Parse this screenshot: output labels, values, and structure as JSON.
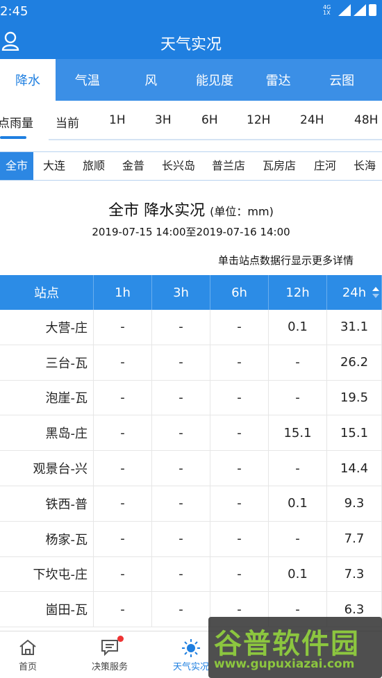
{
  "status_bar": {
    "time": "2:45",
    "network": "4G 1X"
  },
  "app": {
    "title": "天气实况"
  },
  "main_tabs": [
    {
      "label": "降水",
      "active": true
    },
    {
      "label": "气温"
    },
    {
      "label": "风"
    },
    {
      "label": "能见度"
    },
    {
      "label": "雷达"
    },
    {
      "label": "云图"
    }
  ],
  "time_tabs": [
    {
      "label": "站点雨量",
      "active": true
    },
    {
      "label": "当前"
    },
    {
      "label": "1H"
    },
    {
      "label": "3H"
    },
    {
      "label": "6H"
    },
    {
      "label": "12H"
    },
    {
      "label": "24H"
    },
    {
      "label": "48H"
    }
  ],
  "area_tabs": [
    {
      "label": "全市",
      "active": true
    },
    {
      "label": "大连"
    },
    {
      "label": "旅顺"
    },
    {
      "label": "金普"
    },
    {
      "label": "长兴岛"
    },
    {
      "label": "普兰店"
    },
    {
      "label": "瓦房店"
    },
    {
      "label": "庄河"
    },
    {
      "label": "长海"
    }
  ],
  "report": {
    "title": "全市 降水实况",
    "unit": "(单位：mm)",
    "range": "2019-07-15 14:00至2019-07-16 14:00",
    "hint": "单击站点数据行显示更多详情"
  },
  "table": {
    "columns": [
      "站点",
      "1h",
      "3h",
      "6h",
      "12h",
      "24h"
    ],
    "sorted_column": "24h",
    "rows": [
      [
        "大营-庄",
        "-",
        "-",
        "-",
        "0.1",
        "31.1"
      ],
      [
        "三台-瓦",
        "-",
        "-",
        "-",
        "-",
        "26.2"
      ],
      [
        "泡崖-瓦",
        "-",
        "-",
        "-",
        "-",
        "19.5"
      ],
      [
        "黑岛-庄",
        "-",
        "-",
        "-",
        "15.1",
        "15.1"
      ],
      [
        "观景台-兴",
        "-",
        "-",
        "-",
        "-",
        "14.4"
      ],
      [
        "铁西-普",
        "-",
        "-",
        "-",
        "0.1",
        "9.3"
      ],
      [
        "杨家-瓦",
        "-",
        "-",
        "-",
        "-",
        "7.7"
      ],
      [
        "下坎屯-庄",
        "-",
        "-",
        "-",
        "0.1",
        "7.3"
      ],
      [
        "崮田-瓦",
        "-",
        "-",
        "-",
        "-",
        "6.3"
      ]
    ]
  },
  "bottom_nav": [
    {
      "label": "首页",
      "icon": "home-icon"
    },
    {
      "label": "决策服务",
      "icon": "message-icon",
      "badge": true
    },
    {
      "label": "天气实况",
      "icon": "sun-icon",
      "active": true
    }
  ],
  "watermark": {
    "brand": "谷普软件园",
    "url": "www.gupuxiazai.com"
  },
  "colors": {
    "primary": "#1f7fe0",
    "tab_bar": "#3b8fe6",
    "table_header": "#2c8ce6",
    "watermark": "#8cc63f"
  }
}
